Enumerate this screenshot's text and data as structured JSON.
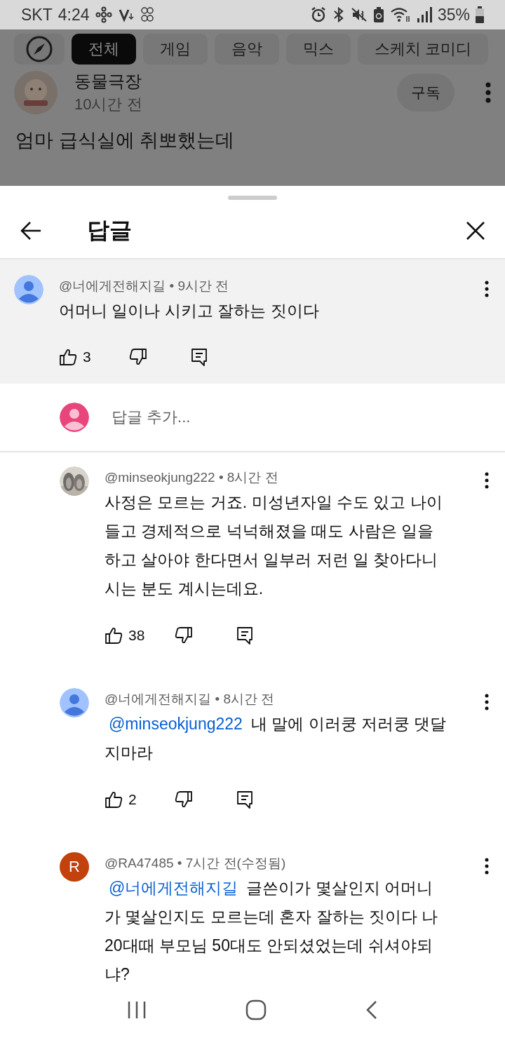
{
  "status_bar": {
    "carrier": "SKT",
    "time": "4:24",
    "battery_percent": "35%"
  },
  "background": {
    "chips": [
      {
        "label": "전체",
        "selected": true
      },
      {
        "label": "게임",
        "selected": false
      },
      {
        "label": "음악",
        "selected": false
      },
      {
        "label": "믹스",
        "selected": false
      },
      {
        "label": "스케치 코미디",
        "selected": false
      }
    ],
    "channel": {
      "name": "동물극장",
      "time": "10시간 전",
      "subscribe": "구독"
    },
    "title": "엄마 급식실에 취뽀했는데"
  },
  "sheet": {
    "title": "답글"
  },
  "parent_comment": {
    "avatar": {
      "kind": "default"
    },
    "meta": "@너에게전해지길 • 9시간 전",
    "text": "어머니 일이나 시키고 잘하는 짓이다",
    "likes": "3"
  },
  "reply_input": {
    "avatar": {
      "kind": "self"
    },
    "placeholder": "답글 추가..."
  },
  "replies": [
    {
      "meta": "@minseokjung222 • 8시간 전",
      "text": "사정은 모르는 거죠. 미성년자일 수도 있고 나이 들고 경제적으로 넉넉해졌을 때도 사람은 일을 하고 살아야 한다면서 일부러 저런 일 찾아다니시는 분도 계시는데요.",
      "likes": "38"
    },
    {
      "avatar": {
        "kind": "default"
      },
      "meta": "@너에게전해지길 • 8시간 전",
      "mention": "@minseokjung222",
      "text": "내 말에 이러쿵 저러쿵 댓달지마라",
      "likes": "2"
    },
    {
      "avatar": {
        "kind": "letter",
        "letter": "R",
        "color": "#c2410c"
      },
      "meta": "@RA47485 • 7시간 전(수정됨)",
      "mention": "@너에게전해지길",
      "text": "글쓴이가 몇살인지 어머니가 몇살인지도 모르는데 혼자 잘하는 짓이다 나 20대때 부모님 50대도 안되셨었는데 쉬셔야되냐?"
    }
  ]
}
